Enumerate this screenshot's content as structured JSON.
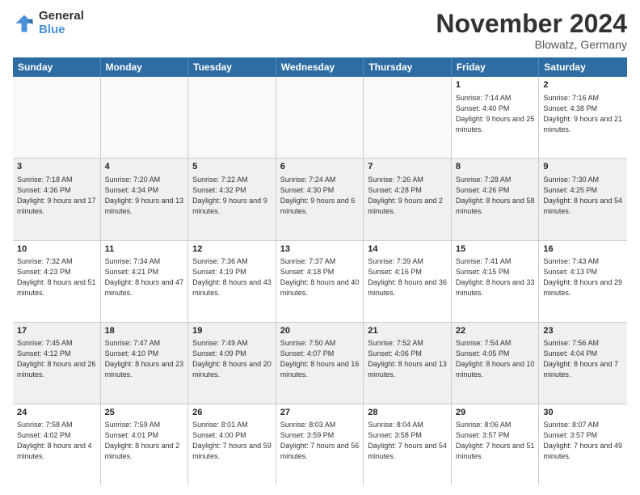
{
  "logo": {
    "general": "General",
    "blue": "Blue"
  },
  "title": "November 2024",
  "location": "Blowatz, Germany",
  "days": [
    "Sunday",
    "Monday",
    "Tuesday",
    "Wednesday",
    "Thursday",
    "Friday",
    "Saturday"
  ],
  "weeks": [
    [
      {
        "day": "",
        "sunrise": "",
        "sunset": "",
        "daylight": "",
        "empty": true
      },
      {
        "day": "",
        "sunrise": "",
        "sunset": "",
        "daylight": "",
        "empty": true
      },
      {
        "day": "",
        "sunrise": "",
        "sunset": "",
        "daylight": "",
        "empty": true
      },
      {
        "day": "",
        "sunrise": "",
        "sunset": "",
        "daylight": "",
        "empty": true
      },
      {
        "day": "",
        "sunrise": "",
        "sunset": "",
        "daylight": "",
        "empty": true
      },
      {
        "day": "1",
        "sunrise": "Sunrise: 7:14 AM",
        "sunset": "Sunset: 4:40 PM",
        "daylight": "Daylight: 9 hours and 25 minutes.",
        "empty": false
      },
      {
        "day": "2",
        "sunrise": "Sunrise: 7:16 AM",
        "sunset": "Sunset: 4:38 PM",
        "daylight": "Daylight: 9 hours and 21 minutes.",
        "empty": false
      }
    ],
    [
      {
        "day": "3",
        "sunrise": "Sunrise: 7:18 AM",
        "sunset": "Sunset: 4:36 PM",
        "daylight": "Daylight: 9 hours and 17 minutes.",
        "empty": false
      },
      {
        "day": "4",
        "sunrise": "Sunrise: 7:20 AM",
        "sunset": "Sunset: 4:34 PM",
        "daylight": "Daylight: 9 hours and 13 minutes.",
        "empty": false
      },
      {
        "day": "5",
        "sunrise": "Sunrise: 7:22 AM",
        "sunset": "Sunset: 4:32 PM",
        "daylight": "Daylight: 9 hours and 9 minutes.",
        "empty": false
      },
      {
        "day": "6",
        "sunrise": "Sunrise: 7:24 AM",
        "sunset": "Sunset: 4:30 PM",
        "daylight": "Daylight: 9 hours and 6 minutes.",
        "empty": false
      },
      {
        "day": "7",
        "sunrise": "Sunrise: 7:26 AM",
        "sunset": "Sunset: 4:28 PM",
        "daylight": "Daylight: 9 hours and 2 minutes.",
        "empty": false
      },
      {
        "day": "8",
        "sunrise": "Sunrise: 7:28 AM",
        "sunset": "Sunset: 4:26 PM",
        "daylight": "Daylight: 8 hours and 58 minutes.",
        "empty": false
      },
      {
        "day": "9",
        "sunrise": "Sunrise: 7:30 AM",
        "sunset": "Sunset: 4:25 PM",
        "daylight": "Daylight: 8 hours and 54 minutes.",
        "empty": false
      }
    ],
    [
      {
        "day": "10",
        "sunrise": "Sunrise: 7:32 AM",
        "sunset": "Sunset: 4:23 PM",
        "daylight": "Daylight: 8 hours and 51 minutes.",
        "empty": false
      },
      {
        "day": "11",
        "sunrise": "Sunrise: 7:34 AM",
        "sunset": "Sunset: 4:21 PM",
        "daylight": "Daylight: 8 hours and 47 minutes.",
        "empty": false
      },
      {
        "day": "12",
        "sunrise": "Sunrise: 7:36 AM",
        "sunset": "Sunset: 4:19 PM",
        "daylight": "Daylight: 8 hours and 43 minutes.",
        "empty": false
      },
      {
        "day": "13",
        "sunrise": "Sunrise: 7:37 AM",
        "sunset": "Sunset: 4:18 PM",
        "daylight": "Daylight: 8 hours and 40 minutes.",
        "empty": false
      },
      {
        "day": "14",
        "sunrise": "Sunrise: 7:39 AM",
        "sunset": "Sunset: 4:16 PM",
        "daylight": "Daylight: 8 hours and 36 minutes.",
        "empty": false
      },
      {
        "day": "15",
        "sunrise": "Sunrise: 7:41 AM",
        "sunset": "Sunset: 4:15 PM",
        "daylight": "Daylight: 8 hours and 33 minutes.",
        "empty": false
      },
      {
        "day": "16",
        "sunrise": "Sunrise: 7:43 AM",
        "sunset": "Sunset: 4:13 PM",
        "daylight": "Daylight: 8 hours and 29 minutes.",
        "empty": false
      }
    ],
    [
      {
        "day": "17",
        "sunrise": "Sunrise: 7:45 AM",
        "sunset": "Sunset: 4:12 PM",
        "daylight": "Daylight: 8 hours and 26 minutes.",
        "empty": false
      },
      {
        "day": "18",
        "sunrise": "Sunrise: 7:47 AM",
        "sunset": "Sunset: 4:10 PM",
        "daylight": "Daylight: 8 hours and 23 minutes.",
        "empty": false
      },
      {
        "day": "19",
        "sunrise": "Sunrise: 7:49 AM",
        "sunset": "Sunset: 4:09 PM",
        "daylight": "Daylight: 8 hours and 20 minutes.",
        "empty": false
      },
      {
        "day": "20",
        "sunrise": "Sunrise: 7:50 AM",
        "sunset": "Sunset: 4:07 PM",
        "daylight": "Daylight: 8 hours and 16 minutes.",
        "empty": false
      },
      {
        "day": "21",
        "sunrise": "Sunrise: 7:52 AM",
        "sunset": "Sunset: 4:06 PM",
        "daylight": "Daylight: 8 hours and 13 minutes.",
        "empty": false
      },
      {
        "day": "22",
        "sunrise": "Sunrise: 7:54 AM",
        "sunset": "Sunset: 4:05 PM",
        "daylight": "Daylight: 8 hours and 10 minutes.",
        "empty": false
      },
      {
        "day": "23",
        "sunrise": "Sunrise: 7:56 AM",
        "sunset": "Sunset: 4:04 PM",
        "daylight": "Daylight: 8 hours and 7 minutes.",
        "empty": false
      }
    ],
    [
      {
        "day": "24",
        "sunrise": "Sunrise: 7:58 AM",
        "sunset": "Sunset: 4:02 PM",
        "daylight": "Daylight: 8 hours and 4 minutes.",
        "empty": false
      },
      {
        "day": "25",
        "sunrise": "Sunrise: 7:59 AM",
        "sunset": "Sunset: 4:01 PM",
        "daylight": "Daylight: 8 hours and 2 minutes.",
        "empty": false
      },
      {
        "day": "26",
        "sunrise": "Sunrise: 8:01 AM",
        "sunset": "Sunset: 4:00 PM",
        "daylight": "Daylight: 7 hours and 59 minutes.",
        "empty": false
      },
      {
        "day": "27",
        "sunrise": "Sunrise: 8:03 AM",
        "sunset": "Sunset: 3:59 PM",
        "daylight": "Daylight: 7 hours and 56 minutes.",
        "empty": false
      },
      {
        "day": "28",
        "sunrise": "Sunrise: 8:04 AM",
        "sunset": "Sunset: 3:58 PM",
        "daylight": "Daylight: 7 hours and 54 minutes.",
        "empty": false
      },
      {
        "day": "29",
        "sunrise": "Sunrise: 8:06 AM",
        "sunset": "Sunset: 3:57 PM",
        "daylight": "Daylight: 7 hours and 51 minutes.",
        "empty": false
      },
      {
        "day": "30",
        "sunrise": "Sunrise: 8:07 AM",
        "sunset": "Sunset: 3:57 PM",
        "daylight": "Daylight: 7 hours and 49 minutes.",
        "empty": false
      }
    ]
  ]
}
